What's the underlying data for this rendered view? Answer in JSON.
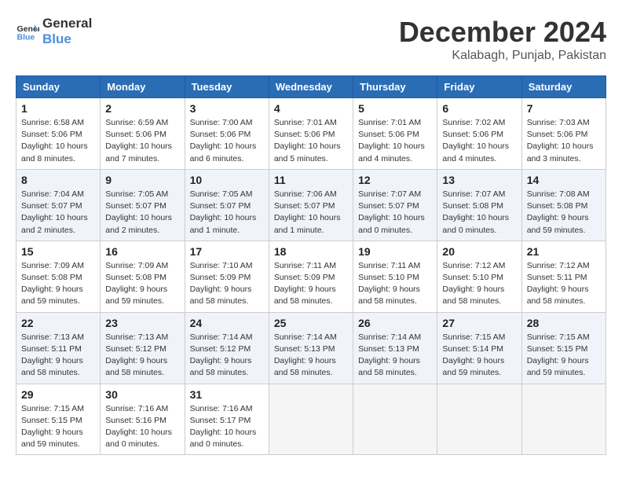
{
  "header": {
    "logo_line1": "General",
    "logo_line2": "Blue",
    "month": "December 2024",
    "location": "Kalabagh, Punjab, Pakistan"
  },
  "days_of_week": [
    "Sunday",
    "Monday",
    "Tuesday",
    "Wednesday",
    "Thursday",
    "Friday",
    "Saturday"
  ],
  "weeks": [
    [
      {
        "day": 1,
        "sunrise": "6:58 AM",
        "sunset": "5:06 PM",
        "daylight": "10 hours and 8 minutes."
      },
      {
        "day": 2,
        "sunrise": "6:59 AM",
        "sunset": "5:06 PM",
        "daylight": "10 hours and 7 minutes."
      },
      {
        "day": 3,
        "sunrise": "7:00 AM",
        "sunset": "5:06 PM",
        "daylight": "10 hours and 6 minutes."
      },
      {
        "day": 4,
        "sunrise": "7:01 AM",
        "sunset": "5:06 PM",
        "daylight": "10 hours and 5 minutes."
      },
      {
        "day": 5,
        "sunrise": "7:01 AM",
        "sunset": "5:06 PM",
        "daylight": "10 hours and 4 minutes."
      },
      {
        "day": 6,
        "sunrise": "7:02 AM",
        "sunset": "5:06 PM",
        "daylight": "10 hours and 4 minutes."
      },
      {
        "day": 7,
        "sunrise": "7:03 AM",
        "sunset": "5:06 PM",
        "daylight": "10 hours and 3 minutes."
      }
    ],
    [
      {
        "day": 8,
        "sunrise": "7:04 AM",
        "sunset": "5:07 PM",
        "daylight": "10 hours and 2 minutes."
      },
      {
        "day": 9,
        "sunrise": "7:05 AM",
        "sunset": "5:07 PM",
        "daylight": "10 hours and 2 minutes."
      },
      {
        "day": 10,
        "sunrise": "7:05 AM",
        "sunset": "5:07 PM",
        "daylight": "10 hours and 1 minute."
      },
      {
        "day": 11,
        "sunrise": "7:06 AM",
        "sunset": "5:07 PM",
        "daylight": "10 hours and 1 minute."
      },
      {
        "day": 12,
        "sunrise": "7:07 AM",
        "sunset": "5:07 PM",
        "daylight": "10 hours and 0 minutes."
      },
      {
        "day": 13,
        "sunrise": "7:07 AM",
        "sunset": "5:08 PM",
        "daylight": "10 hours and 0 minutes."
      },
      {
        "day": 14,
        "sunrise": "7:08 AM",
        "sunset": "5:08 PM",
        "daylight": "9 hours and 59 minutes."
      }
    ],
    [
      {
        "day": 15,
        "sunrise": "7:09 AM",
        "sunset": "5:08 PM",
        "daylight": "9 hours and 59 minutes."
      },
      {
        "day": 16,
        "sunrise": "7:09 AM",
        "sunset": "5:08 PM",
        "daylight": "9 hours and 59 minutes."
      },
      {
        "day": 17,
        "sunrise": "7:10 AM",
        "sunset": "5:09 PM",
        "daylight": "9 hours and 58 minutes."
      },
      {
        "day": 18,
        "sunrise": "7:11 AM",
        "sunset": "5:09 PM",
        "daylight": "9 hours and 58 minutes."
      },
      {
        "day": 19,
        "sunrise": "7:11 AM",
        "sunset": "5:10 PM",
        "daylight": "9 hours and 58 minutes."
      },
      {
        "day": 20,
        "sunrise": "7:12 AM",
        "sunset": "5:10 PM",
        "daylight": "9 hours and 58 minutes."
      },
      {
        "day": 21,
        "sunrise": "7:12 AM",
        "sunset": "5:11 PM",
        "daylight": "9 hours and 58 minutes."
      }
    ],
    [
      {
        "day": 22,
        "sunrise": "7:13 AM",
        "sunset": "5:11 PM",
        "daylight": "9 hours and 58 minutes."
      },
      {
        "day": 23,
        "sunrise": "7:13 AM",
        "sunset": "5:12 PM",
        "daylight": "9 hours and 58 minutes."
      },
      {
        "day": 24,
        "sunrise": "7:14 AM",
        "sunset": "5:12 PM",
        "daylight": "9 hours and 58 minutes."
      },
      {
        "day": 25,
        "sunrise": "7:14 AM",
        "sunset": "5:13 PM",
        "daylight": "9 hours and 58 minutes."
      },
      {
        "day": 26,
        "sunrise": "7:14 AM",
        "sunset": "5:13 PM",
        "daylight": "9 hours and 58 minutes."
      },
      {
        "day": 27,
        "sunrise": "7:15 AM",
        "sunset": "5:14 PM",
        "daylight": "9 hours and 59 minutes."
      },
      {
        "day": 28,
        "sunrise": "7:15 AM",
        "sunset": "5:15 PM",
        "daylight": "9 hours and 59 minutes."
      }
    ],
    [
      {
        "day": 29,
        "sunrise": "7:15 AM",
        "sunset": "5:15 PM",
        "daylight": "9 hours and 59 minutes."
      },
      {
        "day": 30,
        "sunrise": "7:16 AM",
        "sunset": "5:16 PM",
        "daylight": "10 hours and 0 minutes."
      },
      {
        "day": 31,
        "sunrise": "7:16 AM",
        "sunset": "5:17 PM",
        "daylight": "10 hours and 0 minutes."
      },
      null,
      null,
      null,
      null
    ]
  ]
}
